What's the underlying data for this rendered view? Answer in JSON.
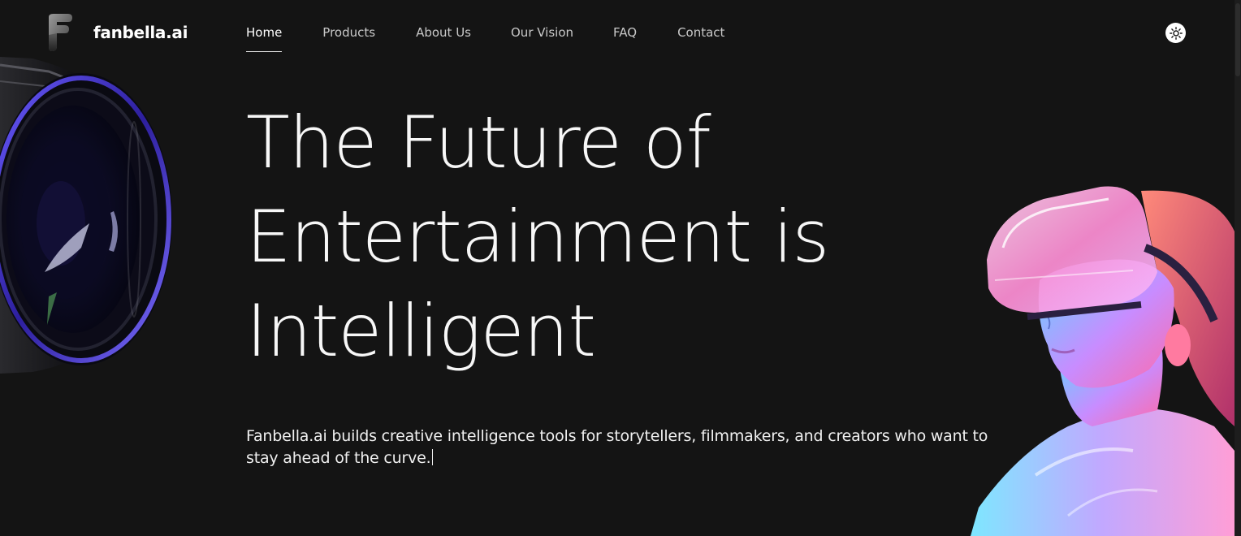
{
  "brand": {
    "name": "fanbella.ai",
    "icon": "logo-f-mark-icon"
  },
  "nav": {
    "items": [
      {
        "label": "Home",
        "active": true
      },
      {
        "label": "Products",
        "active": false
      },
      {
        "label": "About Us",
        "active": false
      },
      {
        "label": "Our Vision",
        "active": false
      },
      {
        "label": "FAQ",
        "active": false
      },
      {
        "label": "Contact",
        "active": false
      }
    ]
  },
  "theme_toggle": {
    "icon": "sun-icon"
  },
  "hero": {
    "title_lines": [
      "The Future of",
      "Entertainment is",
      "Intelligent"
    ],
    "subtitle": "Fanbella.ai builds creative intelligence tools for storytellers, filmmakers, and creators who want to stay ahead of the curve."
  },
  "colors": {
    "background": "#141414",
    "text": "#f7f7f7",
    "nav_text": "#c9c9c9",
    "lens_accent": "#4b3bd6",
    "neon_pink": "#ff5fb8",
    "neon_cyan": "#4fd8ff"
  },
  "images": {
    "left": "camera-lens-image",
    "right": "vr-headset-woman-image"
  }
}
